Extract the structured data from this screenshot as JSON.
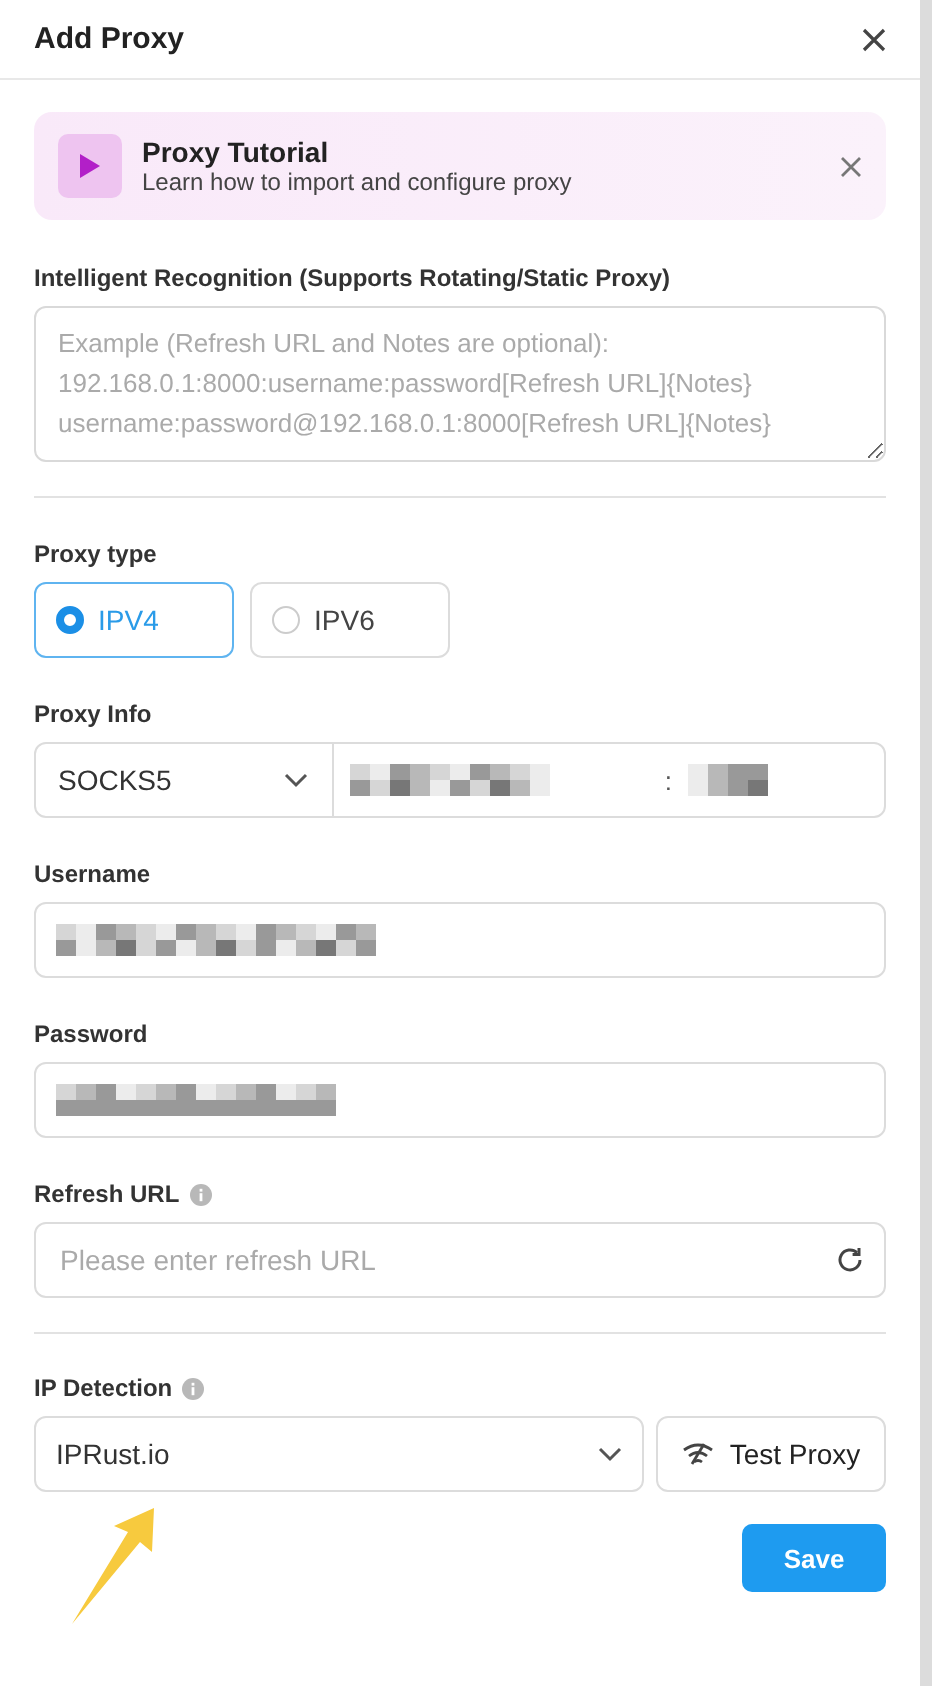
{
  "dialog": {
    "title": "Add Proxy"
  },
  "tutorial": {
    "title": "Proxy Tutorial",
    "subtitle": "Learn how to import and configure proxy"
  },
  "recognition": {
    "label": "Intelligent Recognition (Supports Rotating/Static Proxy)",
    "placeholder": "Example (Refresh URL and Notes are optional):\n192.168.0.1:8000:username:password[Refresh URL]{Notes}\nusername:password@192.168.0.1:8000[Refresh URL]{Notes}"
  },
  "proxy_type": {
    "label": "Proxy type",
    "options": [
      {
        "label": "IPV4",
        "selected": true
      },
      {
        "label": "IPV6",
        "selected": false
      }
    ]
  },
  "proxy_info": {
    "label": "Proxy Info",
    "protocol": "SOCKS5",
    "separator": ":"
  },
  "username": {
    "label": "Username"
  },
  "password": {
    "label": "Password"
  },
  "refresh_url": {
    "label": "Refresh URL",
    "placeholder": "Please enter refresh URL"
  },
  "ip_detection": {
    "label": "IP Detection",
    "value": "IPRust.io",
    "test_button": "Test Proxy"
  },
  "save_button": "Save"
}
